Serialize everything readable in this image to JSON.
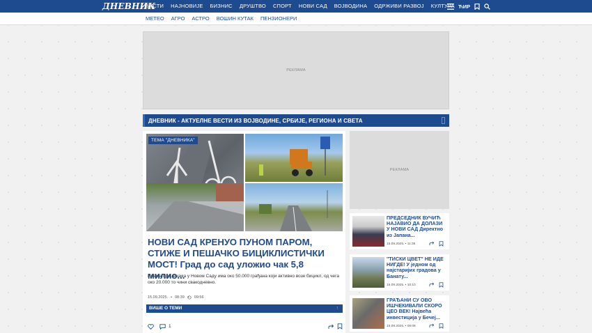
{
  "header": {
    "logo": "ДНЕВНИК",
    "nav": [
      "ВЕСТИ",
      "НАЈНОВИЈЕ",
      "БИЗНИС",
      "ДРУШТВО",
      "СПОРТ",
      "НОВИ САД",
      "ВОЈВОДИНА",
      "ОДРЖИВИ РАЗВОЈ",
      "КУЛТУРА"
    ],
    "script_toggle": "ЋИР",
    "icons": [
      "menu-icon",
      "bookmark-icon",
      "search-icon"
    ]
  },
  "subnav": [
    "МЕТЕО",
    "АГРО",
    "АСТРО",
    "ВОШИН КУТАК",
    "ПЕНЗИОНЕРИ"
  ],
  "ads": {
    "top_label": "РЕКЛАМА",
    "side_label": "РЕКЛАМА"
  },
  "banner": {
    "title": "ДНЕВНИК - АКТУЕЛНЕ ВЕСТИ ИЗ ВОЈВОДИНЕ, СРБИЈЕ, РЕГИОНА И СВЕТА"
  },
  "main_article": {
    "tag": "ТЕМА \"ДНЕВНИКА\"",
    "headline": "НОВИ САД КРЕНУО ПУНОМ ПАРОМ, СТИЖЕ И ПЕШАЧКО БИЦИКЛИСТИЧКИ МОСТ! Град до сад уложио чак 5,8 милио...",
    "lead": "Према проценама у Новом Саду има око 50.000 грађана који активно возе бицикл, од чега око 20.000 то чини свакодневно.",
    "date": "15.09.2025.",
    "time": "08:39",
    "updated": "09:56",
    "more_label": "ВИШЕ О ТЕМИ",
    "likes": "",
    "comments": "1"
  },
  "side_news": [
    {
      "title": "ПРЕДСЕДНИК ВУЧИЋ НАЈАВИО ДА ДОЛАЗИ У НОВИ САД Директно из Јапана...",
      "date": "15.09.2025.",
      "time": "11:36"
    },
    {
      "title": "\"ТИСКИ ЦВЕТ\" НЕ ИДЕ НИГДЕ! У једном од најстаријих градова у Банату...",
      "date": "15.09.2025.",
      "time": "10:10"
    },
    {
      "title": "ГРАЂАНИ СУ ОВО ИШЧЕКИВАЛИ СКОРО ЦЕО ВЕК! Највећа инвестиција у Бечеј...",
      "date": "15.09.2025.",
      "time": "09:08"
    }
  ],
  "colors": {
    "primary": "#1e4b8f",
    "background": "#f1f1f1",
    "ad": "#dcdcdc"
  }
}
